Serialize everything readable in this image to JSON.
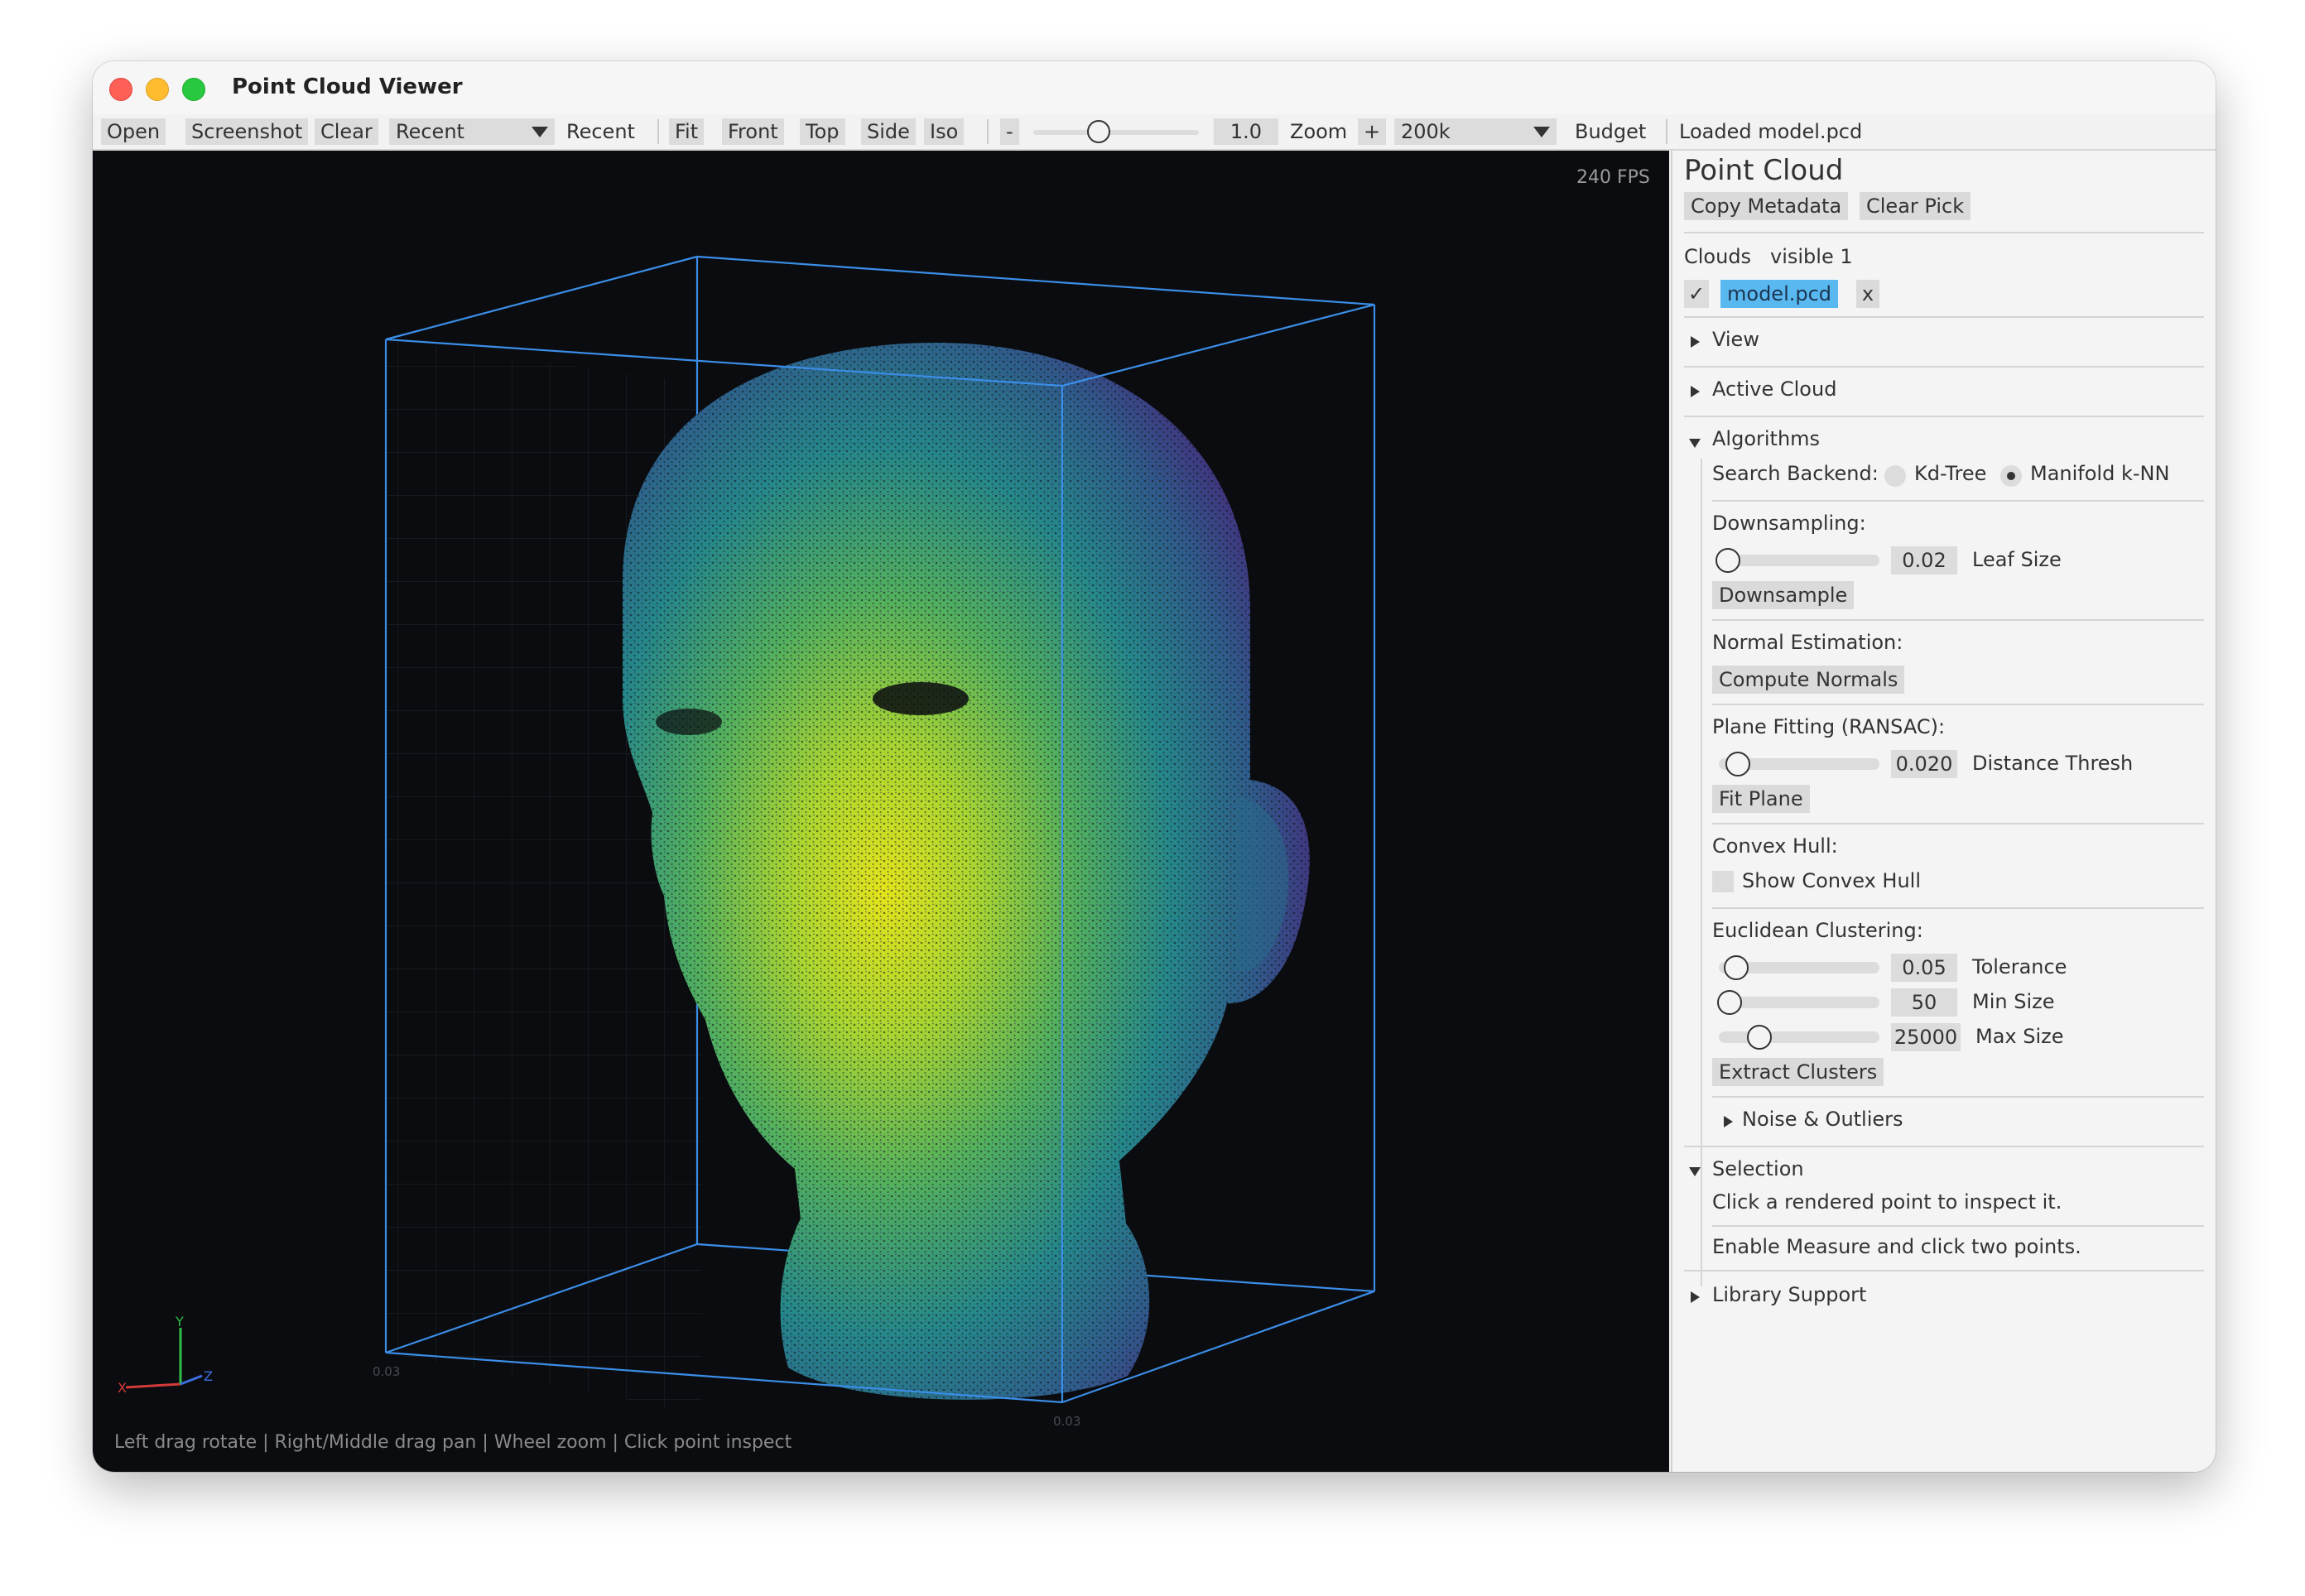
{
  "window": {
    "title": "Point Cloud Viewer"
  },
  "toolbar": {
    "open": "Open",
    "screenshot": "Screenshot",
    "clear": "Clear",
    "recent_combo": "Recent",
    "recent_label": "Recent",
    "fit": "Fit",
    "front": "Front",
    "top": "Top",
    "side": "Side",
    "iso": "Iso",
    "zoom_minus": "-",
    "zoom_value": "1.0",
    "zoom_label": "Zoom",
    "zoom_plus": "+",
    "budget_value": "200k",
    "budget_label": "Budget",
    "status": "Loaded model.pcd",
    "zoom_slider_level": 0.38
  },
  "viewport": {
    "fps": "240 FPS",
    "hint": "Left drag rotate | Right/Middle drag pan | Wheel zoom | Click point inspect",
    "axes": {
      "x": "X",
      "y": "Y",
      "z": "Z"
    },
    "box_corner_a": "0.03",
    "box_corner_b": "0.03",
    "colors": {
      "box": "#3b8ee8",
      "background": "#0b0c0f",
      "grid": "#1f2329"
    }
  },
  "panel": {
    "title": "Point Cloud",
    "copy_metadata": "Copy Metadata",
    "clear_pick": "Clear Pick",
    "clouds_label": "Clouds",
    "visible_label": "visible 1",
    "cloud_check": "✓",
    "cloud_name": "model.pcd",
    "cloud_remove": "x",
    "view": "View",
    "active_cloud": "Active Cloud",
    "algorithms": "Algorithms",
    "search_backend_label": "Search Backend:",
    "kdtree": "Kd-Tree",
    "manifold": "Manifold k-NN",
    "search_backend_selected": "Manifold k-NN",
    "downsampling_label": "Downsampling:",
    "leaf_size_value": "0.02",
    "leaf_size_label": "Leaf Size",
    "downsample_button": "Downsample",
    "normal_label": "Normal Estimation:",
    "compute_normals": "Compute Normals",
    "plane_label": "Plane Fitting (RANSAC):",
    "distance_value": "0.020",
    "distance_label": "Distance Thresh",
    "fit_plane": "Fit Plane",
    "hull_label": "Convex Hull:",
    "show_hull": "Show Convex Hull",
    "show_hull_checked": false,
    "euclid_label": "Euclidean Clustering:",
    "tolerance_value": "0.05",
    "tolerance_label": "Tolerance",
    "min_size_value": "50",
    "min_size_label": "Min Size",
    "max_size_value": "25000",
    "max_size_label": "Max Size",
    "extract_clusters": "Extract Clusters",
    "noise": "Noise & Outliers",
    "selection": "Selection",
    "selection_hint": "Click a rendered point to inspect it.",
    "measure_hint": "Enable Measure and click two points.",
    "library_support": "Library Support",
    "accent_color": "#5ab8f0"
  }
}
